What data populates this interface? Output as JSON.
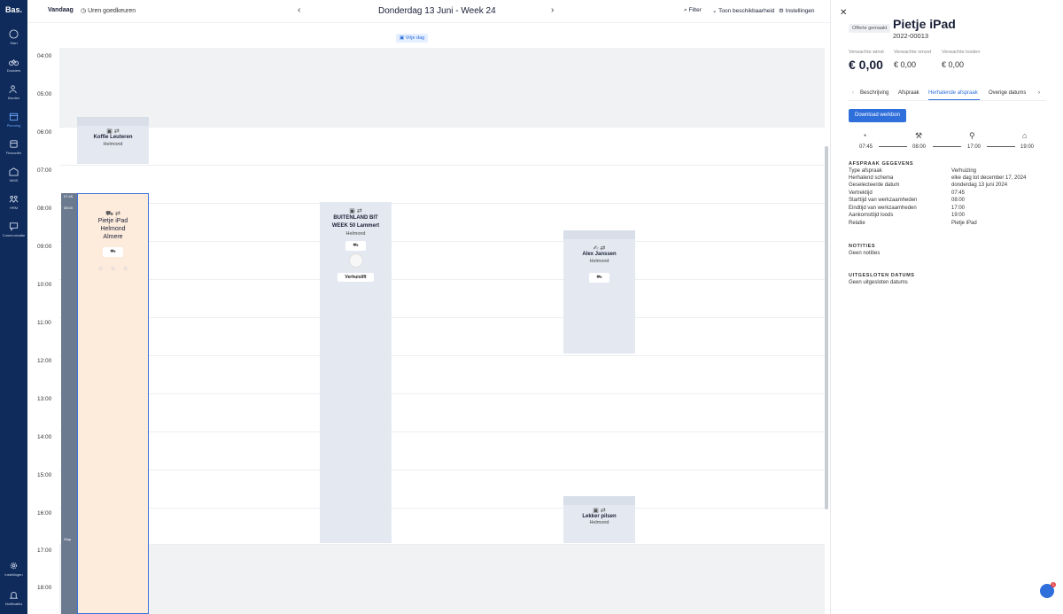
{
  "app": {
    "logo": "Bas."
  },
  "sidebar": {
    "items": [
      {
        "label": "Start",
        "icon": "compass-icon"
      },
      {
        "label": "Dossiers",
        "icon": "bicycle-icon"
      },
      {
        "label": "Klanten",
        "icon": "users-icon"
      },
      {
        "label": "Planning",
        "icon": "calendar-icon"
      },
      {
        "label": "Financiën",
        "icon": "coins-icon"
      },
      {
        "label": "WMS",
        "icon": "warehouse-icon"
      },
      {
        "label": "HRM",
        "icon": "people-icon"
      },
      {
        "label": "Communicatie",
        "icon": "chat-icon"
      }
    ],
    "bottom": [
      {
        "label": "Instellingen",
        "icon": "gear-icon"
      },
      {
        "label": "Notificaties",
        "icon": "bell-icon"
      }
    ]
  },
  "toolbar": {
    "today": "Vandaag",
    "approve_hours": "Uren goedkeuren",
    "date_title": "Donderdag 13 Juni - Week 24",
    "filter": "Filter",
    "show_availability": "Toon beschikbaarheid",
    "settings": "Instellingen"
  },
  "calendar": {
    "day_off": "Vrije dag",
    "hours": [
      "04:00",
      "05:00",
      "06:00",
      "07:00",
      "08:00",
      "09:00",
      "10:00",
      "11:00",
      "12:00",
      "13:00",
      "14:00",
      "15:00",
      "16:00",
      "17:00",
      "18:00"
    ],
    "lane_times": {
      "start": "07:45",
      "work": "08:00",
      "end": "Stop"
    },
    "blocks": {
      "koffie": {
        "title": "Koffie Leuteren",
        "city": "Helmond"
      },
      "pietje": {
        "title": "Pietje iPad",
        "city": "Helmond",
        "city2": "Almere"
      },
      "buitenland": {
        "title": "BUITENLAND BIT WEEK 50 Lammert",
        "city": "Helmond",
        "button": "Verhuislift"
      },
      "alex": {
        "title": "Alex Janssen",
        "city": "Helmond"
      },
      "lekker": {
        "title": "Lekker pilsen",
        "city": "Helmond"
      }
    }
  },
  "panel": {
    "badge": "Offerte gemaakt",
    "title": "Pietje iPad",
    "code": "2022-00013",
    "kpis": [
      {
        "label": "Verwachte winst",
        "value": "€ 0,00"
      },
      {
        "label": "Verwachte omzet",
        "value": "€ 0,00"
      },
      {
        "label": "Verwachte kosten",
        "value": "€ 0,00"
      }
    ],
    "tabs": [
      "Beschrijving",
      "Afspraak",
      "Herhalende afspraak",
      "Overige datums"
    ],
    "active_tab": "Herhalende afspraak",
    "download_button": "Download werkbon",
    "timeline": [
      {
        "icon": "speedometer-icon",
        "time": "07:45"
      },
      {
        "icon": "worker-icon",
        "time": "08:00"
      },
      {
        "icon": "walker-icon",
        "time": "17:00"
      },
      {
        "icon": "depot-icon",
        "time": "19:00"
      }
    ],
    "appointment_header": "AFSPRAAK GEGEVENS",
    "appointment": [
      {
        "k": "Type afspraak",
        "v": "Verhuizing"
      },
      {
        "k": "Herhalend schema",
        "v": "elke dag tot december 17, 2024"
      },
      {
        "k": "Geselecteerde datum",
        "v": "donderdag 13 juni 2024"
      },
      {
        "k": "Vertrektijd",
        "v": "07:45"
      },
      {
        "k": "Starttijd van werkzaamheden",
        "v": "08:00"
      },
      {
        "k": "Eindtijd van werkzaamheden",
        "v": "17:00"
      },
      {
        "k": "Aankomsttijd loods",
        "v": "19:00"
      },
      {
        "k": "Relatie",
        "v": "Pietje iPad"
      }
    ],
    "notes_header": "NOTITIES",
    "notes": "Geen notities",
    "excluded_header": "UITGESLOTEN DATUMS",
    "excluded": "Geen uitgesloten datums"
  },
  "chat": {
    "unread": "1"
  }
}
